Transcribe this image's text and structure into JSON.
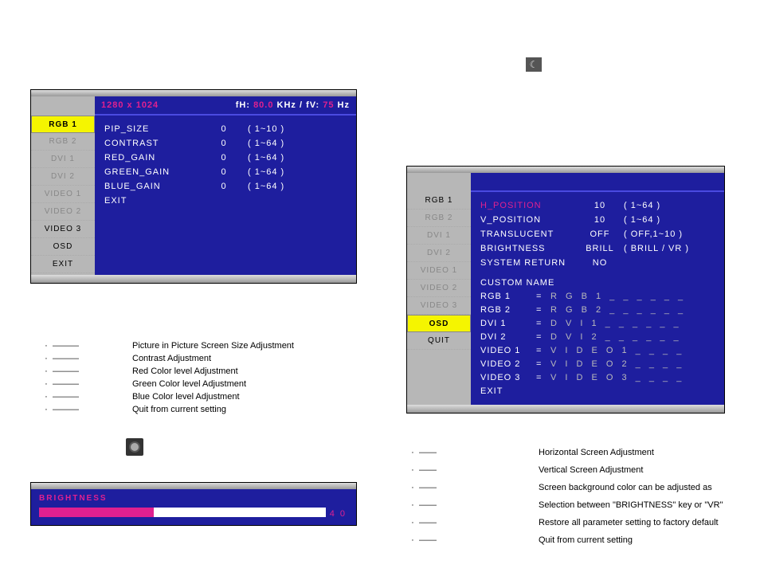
{
  "moon_icon": "☾",
  "panel1": {
    "resolution": "1280 x 1024",
    "freq_label_h": "fH:",
    "freq_val_h": "80.0",
    "freq_unit_h": "KHz /",
    "freq_label_v": "fV:",
    "freq_val_v": "75",
    "freq_unit_v": "Hz",
    "sidebar": [
      {
        "label": "RGB 1",
        "state": "active"
      },
      {
        "label": "RGB 2",
        "state": "disabled"
      },
      {
        "label": "DVI 1",
        "state": "disabled"
      },
      {
        "label": "DVI 2",
        "state": "disabled"
      },
      {
        "label": "VIDEO 1",
        "state": "disabled"
      },
      {
        "label": "VIDEO 2",
        "state": "disabled"
      },
      {
        "label": "VIDEO 3",
        "state": "enabled"
      },
      {
        "label": "OSD",
        "state": "enabled"
      },
      {
        "label": "EXIT",
        "state": "enabled"
      }
    ],
    "params": [
      {
        "label": "PIP_SIZE",
        "val": "0",
        "range": "( 1~10 )"
      },
      {
        "label": "CONTRAST",
        "val": "0",
        "range": "( 1~64 )"
      },
      {
        "label": "RED_GAIN",
        "val": "0",
        "range": "( 1~64 )"
      },
      {
        "label": "GREEN_GAIN",
        "val": "0",
        "range": "( 1~64 )"
      },
      {
        "label": "BLUE_GAIN",
        "val": "0",
        "range": "( 1~64 )"
      },
      {
        "label": "EXIT",
        "val": "",
        "range": ""
      }
    ]
  },
  "panel2": {
    "sidebar": [
      {
        "label": "RGB 1",
        "state": "enabled"
      },
      {
        "label": "RGB 2",
        "state": "disabled"
      },
      {
        "label": "DVI 1",
        "state": "disabled"
      },
      {
        "label": "DVI 2",
        "state": "disabled"
      },
      {
        "label": "VIDEO 1",
        "state": "disabled"
      },
      {
        "label": "VIDEO 2",
        "state": "disabled"
      },
      {
        "label": "VIDEO 3",
        "state": "disabled"
      },
      {
        "label": "OSD",
        "state": "active"
      },
      {
        "label": "QUIT",
        "state": "enabled"
      }
    ],
    "params": [
      {
        "label": "H_POSITION",
        "val": "10",
        "range": "( 1~64 )",
        "hl": true
      },
      {
        "label": "V_POSITION",
        "val": "10",
        "range": "( 1~64 )"
      },
      {
        "label": "TRANSLUCENT",
        "val": "OFF",
        "range": "( OFF,1~10 )"
      },
      {
        "label": "BRIGHTNESS",
        "val": "BRILL",
        "range": "( BRILL / VR )"
      },
      {
        "label": "SYSTEM RETURN",
        "val": "NO",
        "range": ""
      }
    ],
    "custom_heading": "CUSTOM NAME",
    "custom_names": [
      {
        "key": "RGB 1",
        "val": "R G B 1 _ _ _ _ _ _"
      },
      {
        "key": "RGB 2",
        "val": "R G B 2 _ _ _ _ _ _"
      },
      {
        "key": "DVI 1",
        "val": "D V I 1 _ _ _ _ _ _"
      },
      {
        "key": "DVI 2",
        "val": "D V I 2 _ _ _ _ _ _"
      },
      {
        "key": "VIDEO 1",
        "val": "V I D E O 1 _ _ _ _"
      },
      {
        "key": "VIDEO 2",
        "val": "V I D E O 2 _ _ _ _"
      },
      {
        "key": "VIDEO 3",
        "val": "V I D E O 3 _ _ _ _"
      }
    ],
    "exit_label": "EXIT"
  },
  "brightness": {
    "label": "BRIGHTNESS",
    "value": "4 0",
    "percent": 40
  },
  "desc1": [
    "Picture in Picture Screen Size Adjustment",
    "Contrast Adjustment",
    "Red Color level Adjustment",
    "Green Color level Adjustment",
    "Blue Color level Adjustment",
    "Quit from current setting"
  ],
  "desc2": [
    "Horizontal Screen Adjustment",
    "Vertical Screen Adjustment",
    "Screen background color can be adjusted as",
    "Selection between \"BRIGHTNESS\" key or \"VR\"",
    "Restore all parameter setting to factory default",
    "Quit from current setting"
  ],
  "dash3": "———",
  "dash2": "——",
  "bullet": "·"
}
